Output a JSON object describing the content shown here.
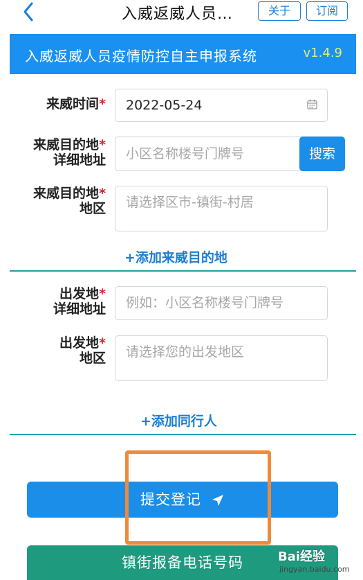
{
  "nav": {
    "title": "入威返威人员…",
    "about_label": "关于",
    "subscribe_label": "订阅"
  },
  "banner": {
    "title": "入威返威人员疫情防控自主申报系统",
    "version": "v1.4.9"
  },
  "form": {
    "arrival_time": {
      "label": "来威时间",
      "required_mark": "*",
      "value": "2022-05-24"
    },
    "destination_address": {
      "label_line1": "来威目的地",
      "label_line2": "详细地址",
      "required_mark": "*",
      "placeholder": "小区名称楼号门牌号",
      "search_label": "搜索"
    },
    "destination_region": {
      "label_line1": "来威目的地",
      "label_line2": "地区",
      "required_mark": "*",
      "placeholder": "请选择区市-镇街-村居"
    },
    "add_destination_label": "+添加来威目的地",
    "departure_address": {
      "label_line1": "出发地",
      "label_line2": "详细地址",
      "required_mark": "*",
      "placeholder": "例如：小区名称楼号门牌号"
    },
    "departure_region": {
      "label_line1": "出发地",
      "label_line2": "地区",
      "required_mark": "*",
      "placeholder": "请选择您的出发地区"
    },
    "add_companion_label": "+添加同行人"
  },
  "actions": {
    "submit_label": "提交登记",
    "phone_label": "镇街报备电话号码"
  },
  "watermark": {
    "logo": "Bai经验",
    "url": "jingyan.baidu.com"
  },
  "colors": {
    "brand_blue": "#1a90f0",
    "button_blue": "#1a8ee8",
    "teal_button": "#1e9a7e",
    "required_red": "#d81e2c",
    "highlight_orange": "#f08a3a",
    "version_yellow": "#e8f06a"
  },
  "icons": {
    "back": "chevron-left-icon",
    "calendar": "calendar-icon",
    "submit": "send-arrow-icon"
  }
}
